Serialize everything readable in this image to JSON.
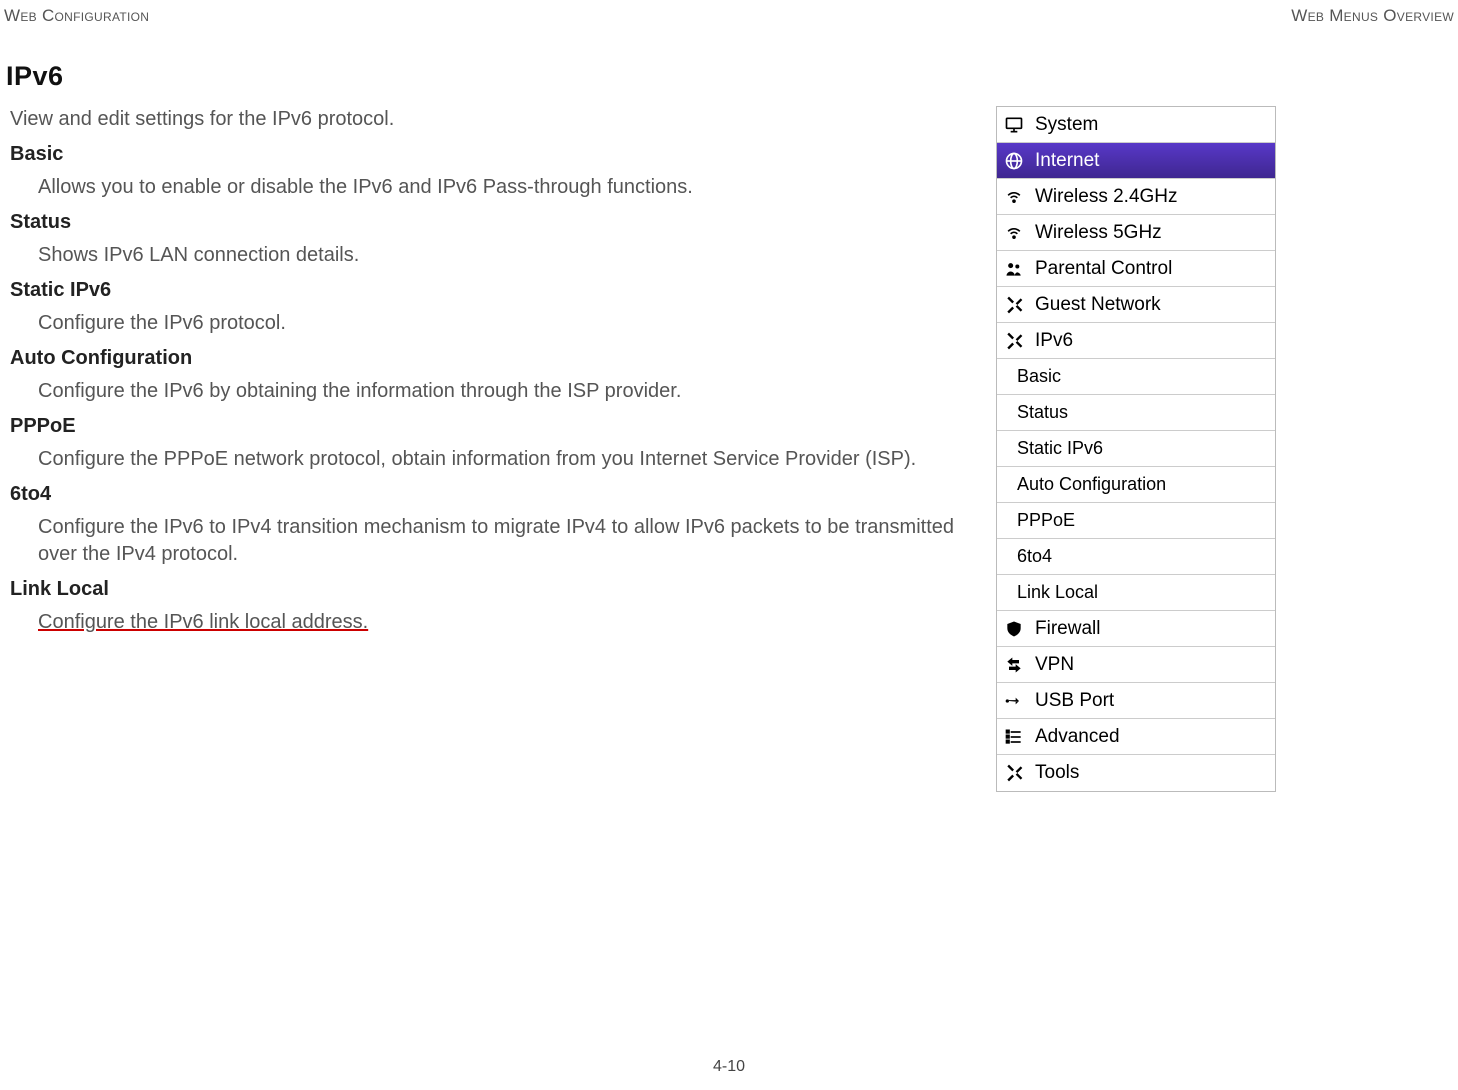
{
  "header": {
    "left": "Web Configuration",
    "right": "Web Menus Overview"
  },
  "title": "IPv6",
  "intro": "View and edit settings for the IPv6 protocol.",
  "sections": {
    "basic": {
      "head": "Basic",
      "desc": "Allows you to enable or disable the IPv6 and IPv6 Pass-through functions."
    },
    "status": {
      "head": "Status",
      "desc": "Shows IPv6 LAN connection details."
    },
    "static": {
      "head": "Static IPv6",
      "desc": "Configure the IPv6 protocol."
    },
    "auto": {
      "head": "Auto Configuration",
      "desc": "Configure the IPv6 by obtaining the information through the ISP provider."
    },
    "pppoe": {
      "head": "PPPoE",
      "desc": "Configure the PPPoE network protocol, obtain information from you Internet Service Provider (ISP)."
    },
    "sixto4": {
      "head": "6to4",
      "desc": "Configure the IPv6 to IPv4 transition mechanism to migrate IPv4 to allow IPv6 packets to be transmitted over the IPv4 protocol."
    },
    "linklocal": {
      "head": "Link Local",
      "desc": "Configure the IPv6 link local address."
    }
  },
  "menu": {
    "system": "System",
    "internet": "Internet",
    "w24": "Wireless 2.4GHz",
    "w5": "Wireless 5GHz",
    "parental": "Parental Control",
    "guest": "Guest Network",
    "ipv6": "IPv6",
    "sub_basic": "Basic",
    "sub_status": "Status",
    "sub_static": "Static IPv6",
    "sub_auto": "Auto Configuration",
    "sub_pppoe": "PPPoE",
    "sub_6to4": "6to4",
    "sub_linklocal": "Link Local",
    "firewall": "Firewall",
    "vpn": "VPN",
    "usb": "USB Port",
    "advanced": "Advanced",
    "tools": "Tools"
  },
  "footer": "4-10"
}
